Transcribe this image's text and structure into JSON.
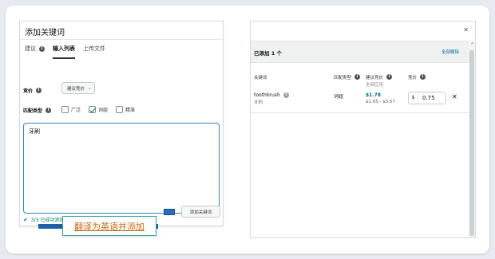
{
  "left_panel": {
    "title": "添加关键词",
    "tabs": [
      {
        "label": "建议",
        "has_info": true
      },
      {
        "label": "输入列表",
        "active": true
      },
      {
        "label": "上传文件"
      }
    ],
    "bid_label": "竞价",
    "bid_select": "建议竞价",
    "match_label": "匹配类型",
    "match_options": [
      {
        "label": "广泛",
        "checked": false
      },
      {
        "label": "词组",
        "checked": true
      },
      {
        "label": "精准",
        "checked": false
      }
    ],
    "textarea_value": "牙刷",
    "success_text": "3/3 已成功添加关键词。",
    "add_button": "添加关键词"
  },
  "tooltip": {
    "text": "翻译为英语并添加"
  },
  "right_panel": {
    "added_title": "已添加 1 个",
    "delete_all": "全部删除",
    "headers": {
      "keyword": "关键词",
      "match_type": "匹配类型",
      "suggested_bid": "建议竞价",
      "suggested_sub": "全部应用",
      "bid": "竞价"
    },
    "rows": [
      {
        "keyword": "toothbrush",
        "keyword_sub": "牙刷",
        "match_type": "词组",
        "suggested": "$1.78",
        "range": "$1.05 - $3.57",
        "currency": "$",
        "bid": "0.75"
      }
    ]
  },
  "colors": {
    "accent": "#2f8ab8",
    "link": "#007185",
    "success": "#067d62",
    "tooltip_text": "#c76a12"
  },
  "icons": [
    "info-icon",
    "chevron-down-icon",
    "check-icon",
    "close-icon",
    "scroll-up-icon",
    "resize-icon"
  ]
}
